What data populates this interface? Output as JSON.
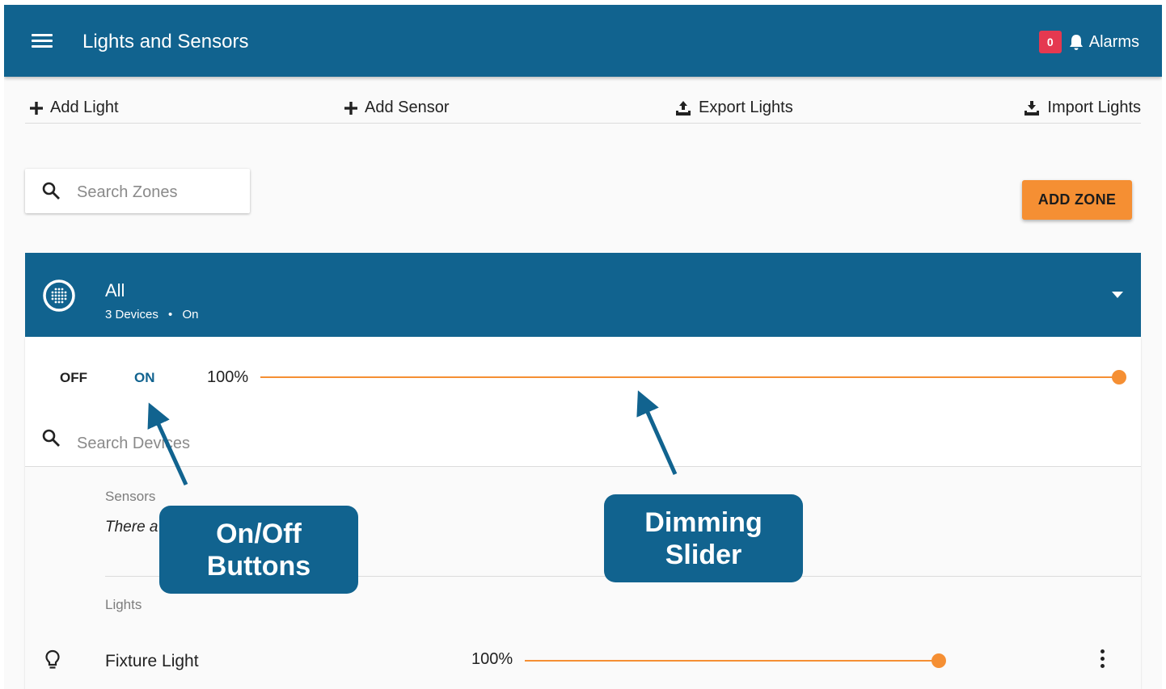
{
  "header": {
    "title": "Lights and Sensors",
    "alarm_count": "0",
    "alarms_label": "Alarms"
  },
  "toolbar": {
    "add_light": "Add Light",
    "add_sensor": "Add Sensor",
    "export_lights": "Export Lights",
    "import_lights": "Import Lights"
  },
  "zones": {
    "search_placeholder": "Search Zones",
    "add_zone_label": "ADD ZONE"
  },
  "zone": {
    "name": "All",
    "devices_count": "3 Devices",
    "separator": "•",
    "state": "On",
    "off_label": "OFF",
    "on_label": "ON",
    "dim_level_text": "100%",
    "dim_level": 1.0,
    "device_search_placeholder": "Search Devices",
    "sensors_label": "Sensors",
    "sensors_empty_text": "There a",
    "lights_label": "Lights",
    "lights": [
      {
        "name": "Fixture Light",
        "level_text": "100%",
        "level": 1.0
      }
    ]
  },
  "callouts": {
    "onoff": "On/Off Buttons",
    "dimming": "Dimming Slider"
  },
  "colors": {
    "primary": "#11638f",
    "accent": "#f58f33",
    "badge": "#e53950"
  }
}
